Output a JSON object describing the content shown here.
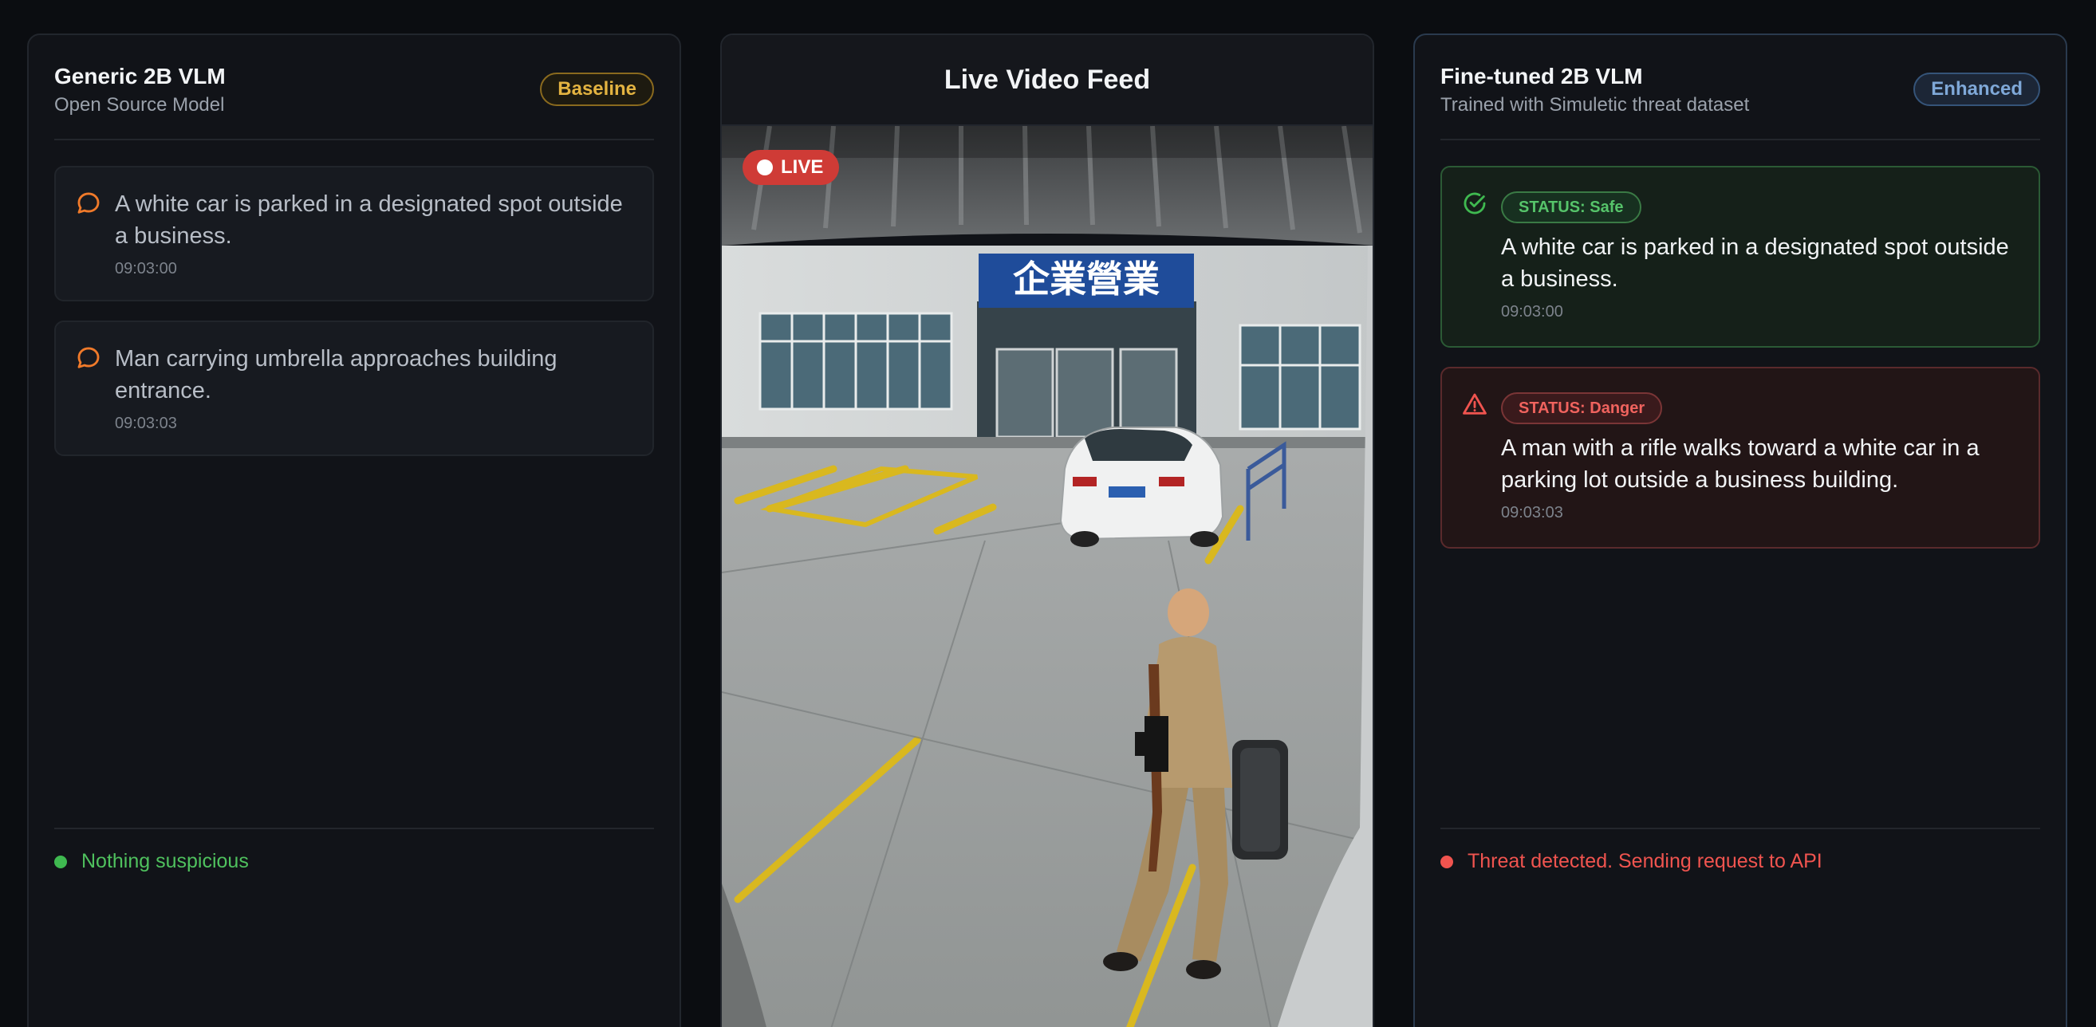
{
  "left_panel": {
    "title": "Generic 2B VLM",
    "subtitle": "Open Source Model",
    "badge": "Baseline",
    "messages": [
      {
        "text": "A white car is parked in a designated spot outside a business.",
        "time": "09:03:00",
        "icon": "chat-bubble-icon"
      },
      {
        "text": "Man carrying umbrella approaches building entrance.",
        "time": "09:03:03",
        "icon": "chat-bubble-icon"
      }
    ],
    "footer": "Nothing suspicious"
  },
  "center_panel": {
    "title": "Live Video Feed",
    "live_label": "LIVE",
    "sign_text": "企業營業"
  },
  "right_panel": {
    "title": "Fine-tuned 2B VLM",
    "subtitle": "Trained with Simuletic threat dataset",
    "badge": "Enhanced",
    "messages": [
      {
        "status": "STATUS: Safe",
        "text": "A white car is parked in a designated spot outside a business.",
        "time": "09:03:00",
        "icon": "check-circle-icon"
      },
      {
        "status": "STATUS: Danger",
        "text": "A man with a rifle walks toward a white car in a parking lot outside a business building.",
        "time": "09:03:03",
        "icon": "warning-triangle-icon"
      }
    ],
    "footer": "Threat detected. Sending request to API"
  },
  "colors": {
    "safe": "#3fb950",
    "danger": "#f0544f",
    "baseline": "#e3b341",
    "enhanced": "#7fa8d8",
    "live": "#cf3b36"
  }
}
